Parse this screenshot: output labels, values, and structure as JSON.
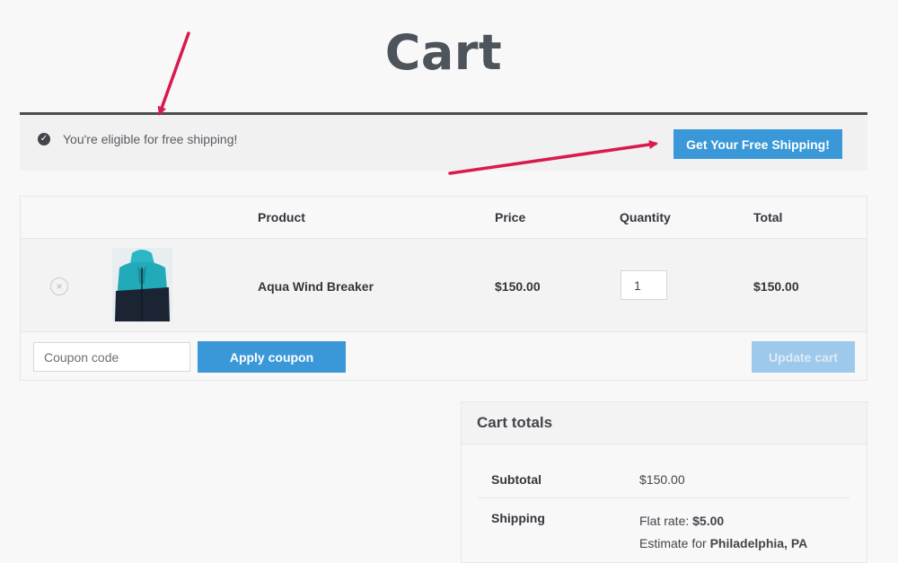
{
  "page": {
    "title": "Cart"
  },
  "notice": {
    "icon": "check-circle-icon",
    "text": "You're eligible for free shipping!",
    "button_label": "Get Your Free Shipping!"
  },
  "cart_table": {
    "headers": {
      "product": "Product",
      "price": "Price",
      "quantity": "Quantity",
      "total": "Total"
    },
    "items": [
      {
        "remove_icon": "close-icon",
        "thumbnail": "jacket-thumbnail",
        "name": "Aqua Wind Breaker",
        "price": "$150.00",
        "quantity": "1",
        "total": "$150.00"
      }
    ],
    "actions": {
      "coupon_placeholder": "Coupon code",
      "apply_label": "Apply coupon",
      "update_label": "Update cart"
    }
  },
  "totals": {
    "title": "Cart totals",
    "subtotal_label": "Subtotal",
    "subtotal_value": "$150.00",
    "shipping_label": "Shipping",
    "flat_rate_prefix": "Flat rate: ",
    "flat_rate_value": "$5.00",
    "estimate_prefix": "Estimate for ",
    "estimate_location": "Philadelphia, PA"
  },
  "colors": {
    "accent": "#3a98d9",
    "accent_disabled": "#9cc9ec",
    "annotation_arrow": "#d81b4c",
    "background": "#f8f8f9"
  }
}
